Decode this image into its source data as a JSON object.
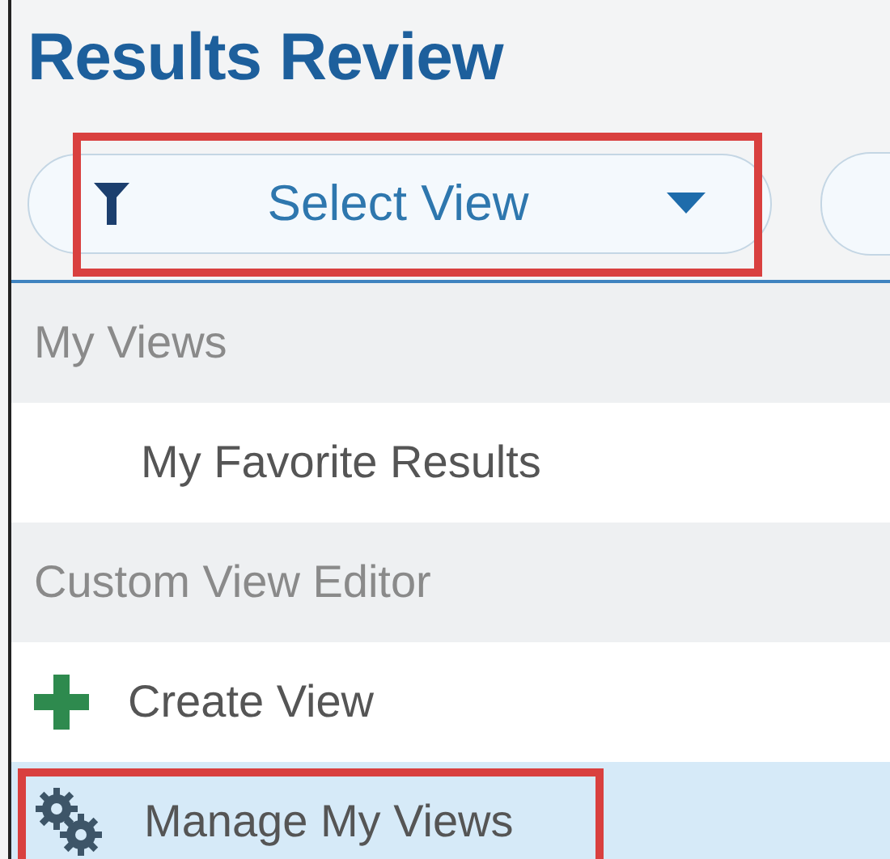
{
  "title": "Results Review",
  "view_selector": {
    "label": "Select View",
    "callout": true
  },
  "menu": [
    {
      "kind": "header",
      "label": "My Views",
      "selected": false,
      "callout": false
    },
    {
      "kind": "option",
      "label": "My Favorite Results",
      "selected": false,
      "callout": false
    },
    {
      "kind": "header",
      "label": "Custom View Editor",
      "selected": false,
      "callout": false
    },
    {
      "kind": "add",
      "label": "Create View",
      "selected": false,
      "callout": false
    },
    {
      "kind": "manage",
      "label": "Manage My Views",
      "selected": true,
      "callout": true
    }
  ]
}
